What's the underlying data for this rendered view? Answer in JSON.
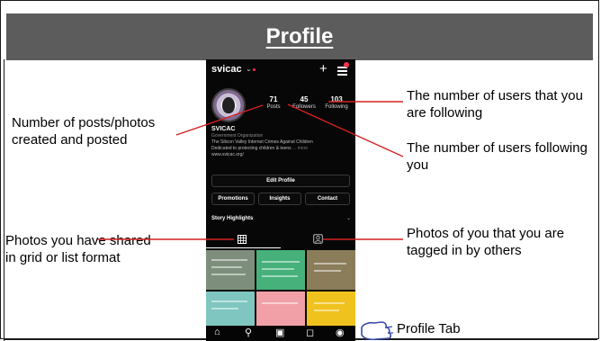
{
  "slide": {
    "title": "Profile"
  },
  "phone": {
    "username": "svicac",
    "stats": [
      {
        "value": "71",
        "label": "Posts"
      },
      {
        "value": "45",
        "label": "Followers"
      },
      {
        "value": "103",
        "label": "Following"
      }
    ],
    "display_name": "SVICAC",
    "bio_line1": "Government Organization",
    "bio_line2": "The Silicon Valley Internet Crimes Against Children",
    "bio_line3": "Dedicated to protecting children & teens",
    "bio_more": "... more",
    "bio_line4": "www.svicac.org/",
    "edit_profile_label": "Edit Profile",
    "promotions_label": "Promotions",
    "insights_label": "Insights",
    "contact_label": "Contact",
    "story_highlights_label": "Story Highlights"
  },
  "annotations": {
    "following_note": "The number of users that you are following",
    "followers_note": "The number of users following you",
    "posts_note": "Number of posts/photos created and posted",
    "grid_note": "Photos you have shared in grid or list format",
    "tagged_note": "Photos of you that you are tagged in by others",
    "profile_tab_note": "Profile Tab"
  },
  "colors": {
    "header_bg": "#5c5c5c",
    "arrow": "#d42020",
    "phone_bg": "#070707",
    "hand_outline": "#3a4aa8"
  },
  "icons": [
    "chevron-down-icon",
    "plus-icon",
    "menu-icon",
    "grid-icon",
    "tagged-icon",
    "home-icon",
    "search-icon",
    "reels-icon",
    "shop-icon",
    "profile-icon",
    "pointing-hand-icon"
  ]
}
